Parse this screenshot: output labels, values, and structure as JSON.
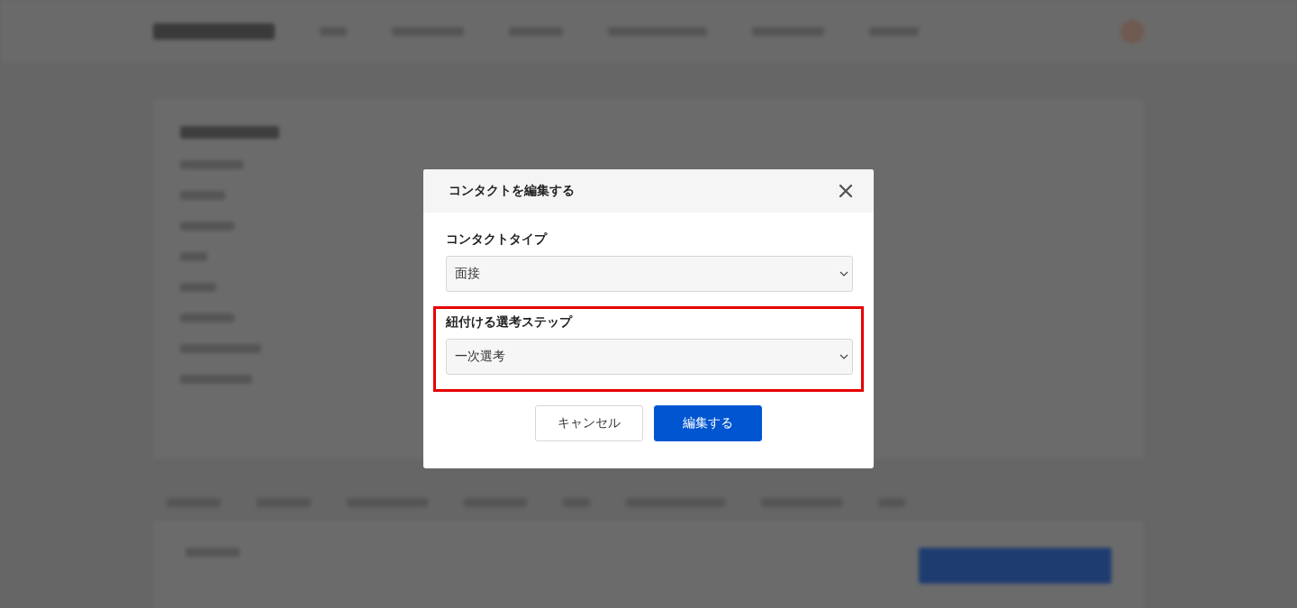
{
  "dialog": {
    "title": "コンタクトを編集する",
    "fields": [
      {
        "label": "コンタクトタイプ",
        "value": "面接",
        "highlighted": false
      },
      {
        "label": "紐付ける選考ステップ",
        "value": "一次選考",
        "highlighted": true
      }
    ],
    "buttons": [
      {
        "label": "キャンセル",
        "kind": "secondary"
      },
      {
        "label": "編集する",
        "kind": "primary"
      }
    ]
  }
}
